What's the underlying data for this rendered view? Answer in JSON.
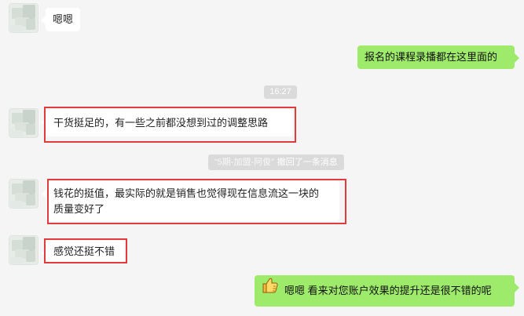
{
  "messages": {
    "msg1": {
      "text": "嗯嗯"
    },
    "msg2": {
      "text": "报名的课程录播都在这里面的"
    },
    "timestamp": "16:27",
    "msg3": {
      "text": "干货挺足的，有一些之前都没想到过的调整思路"
    },
    "recall": {
      "name": "“5期-加盟-阿俊”",
      "text": "撤回了一条消息"
    },
    "msg4": {
      "line1": "钱花的挺值，最实际的就是销售也觉得现在信息流这一块的",
      "line2": "质量变好了"
    },
    "msg5": {
      "text": "感觉还挺不错"
    },
    "msg6": {
      "text": "嗯嗯 看来对您账户效果的提升还是很不错的呢"
    }
  },
  "colors": {
    "background": "#f5f5f5",
    "incoming_bubble": "#ffffff",
    "outgoing_bubble": "#9eea6a",
    "highlight_border": "#e23b3b",
    "system_bg": "#dadada"
  },
  "icons": {
    "thumbs_up": "thumbs-up-icon"
  }
}
